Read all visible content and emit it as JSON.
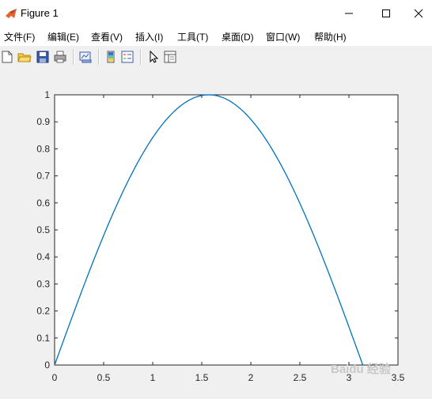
{
  "window": {
    "title": "Figure 1"
  },
  "menu": {
    "items": [
      {
        "label": "文件(F)"
      },
      {
        "label": "编辑(E)"
      },
      {
        "label": "查看(V)"
      },
      {
        "label": "插入(I)"
      },
      {
        "label": "工具(T)"
      },
      {
        "label": "桌面(D)"
      },
      {
        "label": "窗口(W)"
      },
      {
        "label": "帮助(H)"
      }
    ]
  },
  "toolbar": {
    "icons": [
      "new-figure-icon",
      "open-file-icon",
      "save-icon",
      "print-icon",
      "link-plot-icon",
      "insert-colorbar-icon",
      "insert-legend-icon",
      "edit-plot-pointer-icon",
      "property-inspector-icon"
    ]
  },
  "colors": {
    "line": "#0072bd",
    "axes_bg": "#ffffff",
    "figure_bg": "#f0f0f0",
    "axis": "#262626"
  },
  "watermark": "Baidu 经验",
  "chart_data": {
    "type": "line",
    "title": "",
    "xlabel": "",
    "ylabel": "",
    "xlim": [
      0,
      3.5
    ],
    "ylim": [
      0,
      1
    ],
    "xticks": [
      "0",
      "0.5",
      "1",
      "1.5",
      "2",
      "2.5",
      "3",
      "3.5"
    ],
    "yticks": [
      "0",
      "0.1",
      "0.2",
      "0.3",
      "0.4",
      "0.5",
      "0.6",
      "0.7",
      "0.8",
      "0.9",
      "1"
    ],
    "grid": false,
    "series": [
      {
        "function": "y = sin(x)",
        "x": [
          0,
          0.25,
          0.5,
          0.75,
          1.0,
          1.25,
          1.5,
          1.5708,
          1.75,
          2.0,
          2.25,
          2.5,
          2.75,
          3.0,
          3.1416
        ],
        "y": [
          0,
          0.247,
          0.479,
          0.682,
          0.841,
          0.949,
          0.997,
          1.0,
          0.984,
          0.909,
          0.778,
          0.598,
          0.382,
          0.141,
          0
        ]
      }
    ]
  }
}
